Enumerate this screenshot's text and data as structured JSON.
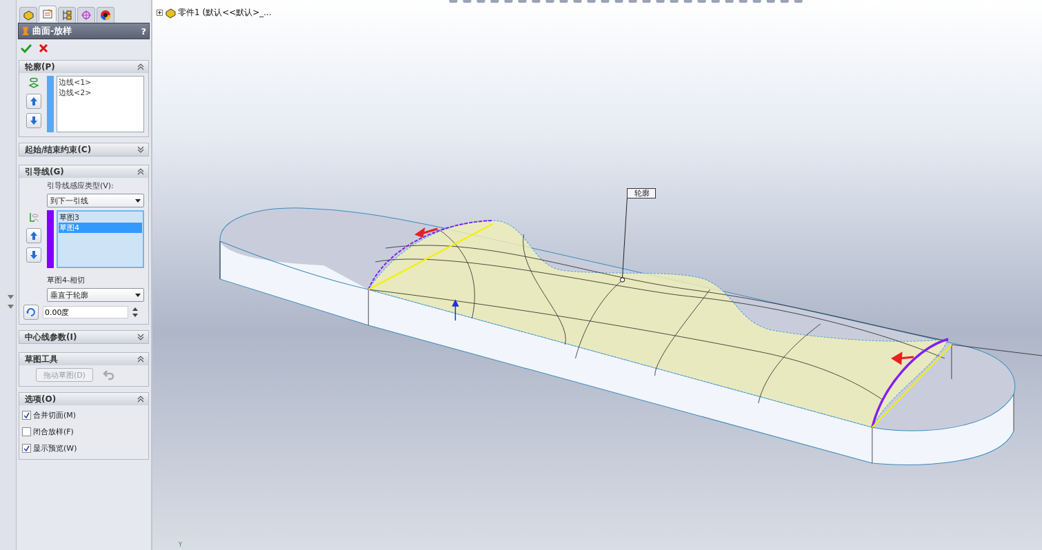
{
  "tabs": [
    {
      "kind": "feature",
      "selected": false
    },
    {
      "kind": "property",
      "selected": true
    },
    {
      "kind": "config",
      "selected": false
    },
    {
      "kind": "dimxpert",
      "selected": false
    },
    {
      "kind": "display",
      "selected": false
    }
  ],
  "panel": {
    "title": "曲面-放样",
    "help": "?"
  },
  "sections": [
    {
      "kind": "list",
      "title": "轮廓(P)",
      "expanded": true,
      "color": "#5aa8f0",
      "items": [
        {
          "label": "边线<1>",
          "selected": false
        },
        {
          "label": "边线<2>",
          "selected": false
        }
      ]
    },
    {
      "kind": "collapsed",
      "title": "起始/结束约束(C)",
      "expanded": false
    },
    {
      "kind": "guides",
      "title": "引导线(G)",
      "expanded": true,
      "type_label": "引导线感应类型(V):",
      "type_value": "到下一引线",
      "color": "#8000ff",
      "items": [
        {
          "label": "草图3",
          "selected": false
        },
        {
          "label": "草图4",
          "selected": true
        }
      ],
      "tangent_label": "草图4-相切",
      "tangent_value": "垂直于轮廓",
      "angle": "0.00度"
    },
    {
      "kind": "collapsed",
      "title": "中心线参数(I)",
      "expanded": false
    },
    {
      "kind": "tools",
      "title": "草图工具",
      "expanded": true,
      "button": {
        "label": "拖动草图(D)",
        "disabled": true
      }
    },
    {
      "kind": "options",
      "title": "选项(O)",
      "expanded": true,
      "options": [
        {
          "label": "合并切面(M)",
          "checked": true
        },
        {
          "label": "闭合放样(F)",
          "checked": false
        },
        {
          "label": "显示预览(W)",
          "checked": true
        }
      ]
    }
  ],
  "viewport": {
    "tree_root": "零件1  (默认<<默认>_...",
    "callout": "轮廓",
    "axis_label": "Y"
  }
}
